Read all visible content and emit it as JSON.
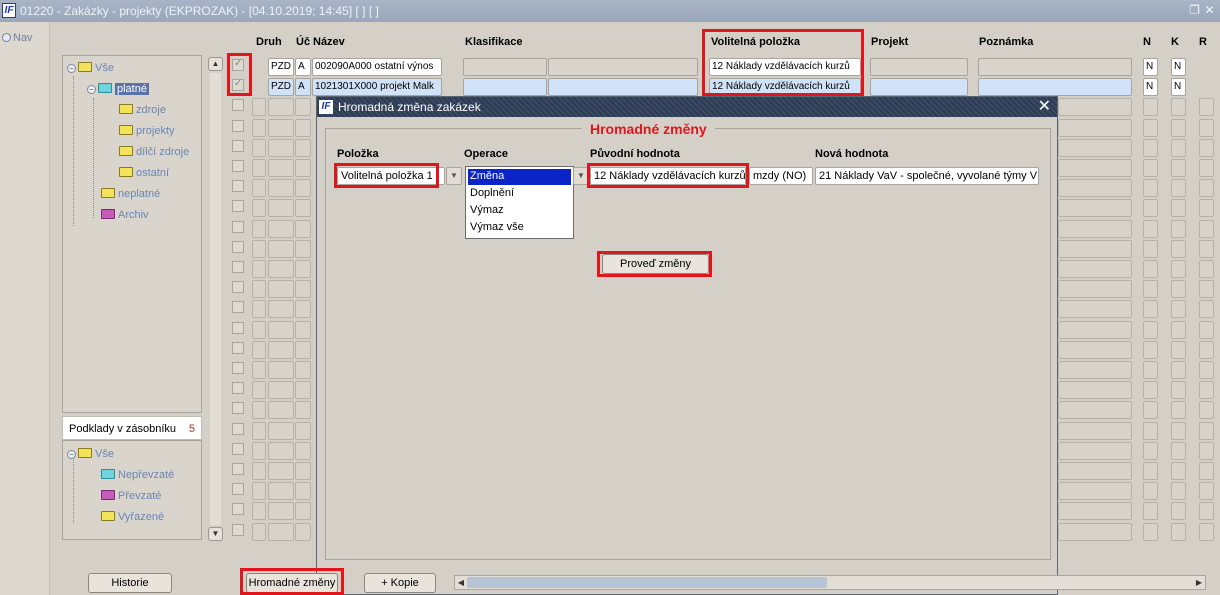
{
  "window": {
    "title": "01220 - Zakázky - projekty (EKPROZAK) - [04.10.2019; 14:45]  [ ]  [ ]",
    "restore_icon": "restore-icon",
    "close_icon": "close-icon"
  },
  "leftstrip": {
    "nav_label": "Nav"
  },
  "tree": {
    "items": [
      {
        "label": "Vše"
      },
      {
        "label": "platné"
      },
      {
        "label": "zdroje"
      },
      {
        "label": "projekty"
      },
      {
        "label": "dílčí zdroje"
      },
      {
        "label": "ostatní"
      },
      {
        "label": "neplatné"
      },
      {
        "label": "Archiv"
      }
    ]
  },
  "podklady": {
    "label": "Podklady v zásobníku",
    "count": "5"
  },
  "tree2": {
    "items": [
      {
        "label": "Vše"
      },
      {
        "label": "Nepřevzaté"
      },
      {
        "label": "Převzaté"
      },
      {
        "label": "Vyřazené"
      }
    ]
  },
  "columns": {
    "druh": "Druh",
    "uc": "Úč",
    "nazev": "Název",
    "klasifikace": "Klasifikace",
    "volitelna": "Volitelná položka",
    "projekt": "Projekt",
    "poznamka": "Poznámka",
    "n": "N",
    "k": "K",
    "r": "R"
  },
  "rows": [
    {
      "druh": "PZD",
      "uc": "A",
      "nazev": "002090A000 ostatní výnos",
      "volitelna": "12 Náklady vzdělávacích kurzů",
      "n": "N",
      "k": "N"
    },
    {
      "druh": "PZD",
      "uc": "A",
      "nazev": "1021301X000 projekt Malk",
      "volitelna": "12 Náklady vzdělávacích kurzů",
      "n": "N",
      "k": "N"
    }
  ],
  "dialog": {
    "title": "Hromadná změna zakázek",
    "section_title": "Hromadné změny",
    "labels": {
      "polozka": "Položka",
      "operace": "Operace",
      "puvodni": "Původní hodnota",
      "nova": "Nová hodnota"
    },
    "polozka_value": "Volitelná položka 1",
    "operace_options": [
      "Změna",
      "Doplnění",
      "Výmaz",
      "Výmaz vše"
    ],
    "operace_selected": "Změna",
    "puvodni_value": "12 Náklady vzdělávacích kurzů",
    "puvodni_extra": "mzdy (NO)",
    "nova_value": "21 Náklady VaV - společné, vyvolané týmy V",
    "apply_button": "Proveď změny"
  },
  "bottom": {
    "historie": "Historie",
    "hromadne": "Hromadné změny",
    "kopie": "+ Kopie"
  },
  "colors": {
    "highlight": "#e2141c",
    "selected_row": "#cfe2f7",
    "list_selection": "#0a24c8"
  }
}
